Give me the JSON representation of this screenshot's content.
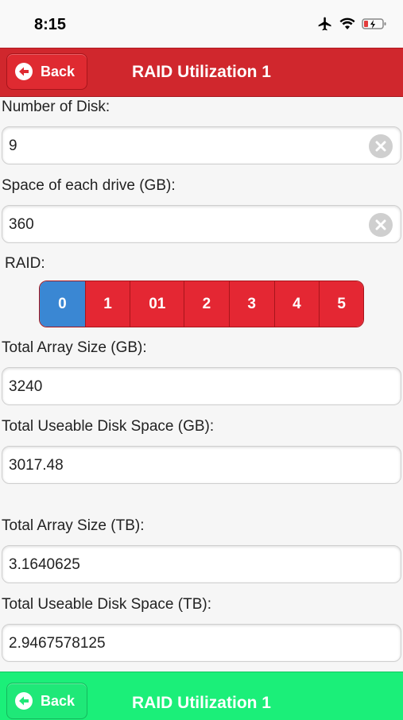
{
  "status": {
    "time": "8:15"
  },
  "header": {
    "back_label": "Back",
    "title": "RAID Utilization 1"
  },
  "footer": {
    "back_label": "Back",
    "title": "RAID Utilization 1"
  },
  "form": {
    "disks_label": "Number of Disk:",
    "disks_value": "9",
    "space_label": "Space of each drive (GB):",
    "space_value": "360",
    "raid_label": "RAID:",
    "raid_options": [
      "0",
      "1",
      "01",
      "2",
      "3",
      "4",
      "5"
    ],
    "raid_selected": "0",
    "array_gb_label": "Total Array Size (GB):",
    "array_gb_value": "3240",
    "usable_gb_label": "Total Useable Disk Space (GB):",
    "usable_gb_value": "3017.48",
    "array_tb_label": "Total Array Size (TB):",
    "array_tb_value": "3.1640625",
    "usable_tb_label": "Total Useable Disk Space (TB):",
    "usable_tb_value": "2.9467578125"
  },
  "colors": {
    "header": "#d0272d",
    "footer": "#1bef79",
    "segment_active": "#3a87d3",
    "segment": "#e42733"
  },
  "icons": {
    "back": "arrow-left-icon",
    "clear": "clear-circle-icon",
    "airplane": "airplane-icon",
    "wifi": "wifi-icon",
    "battery": "battery-charging-icon"
  }
}
